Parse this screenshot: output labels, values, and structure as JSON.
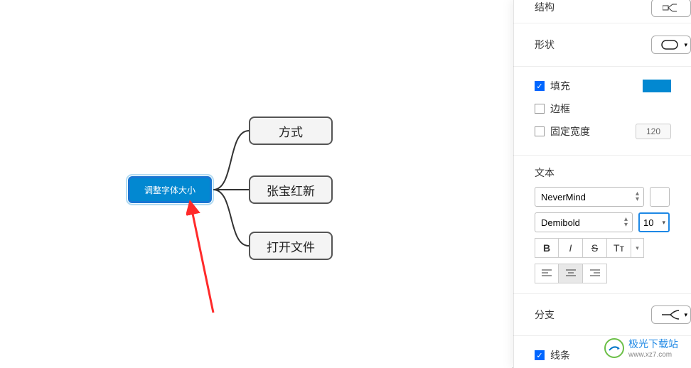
{
  "mindmap": {
    "root_label": "调整字体大小",
    "children": [
      "方式",
      "张宝红新",
      "打开文件"
    ]
  },
  "panel": {
    "structure_label": "结构",
    "shape_label": "形状",
    "fill_label": "填充",
    "border_label": "边框",
    "fixed_width_label": "固定宽度",
    "fixed_width_value": "120",
    "text_section_label": "文本",
    "font_family": "NeverMind",
    "font_weight": "Demibold",
    "font_size": "10",
    "style_buttons": {
      "bold": "B",
      "italic": "I",
      "strike": "S",
      "case": "Tᴛ"
    },
    "branch_label": "分支",
    "line_label": "线条",
    "fill_color": "#0288d1"
  },
  "watermark": {
    "name": "极光下载站",
    "url": "www.xz7.com"
  }
}
